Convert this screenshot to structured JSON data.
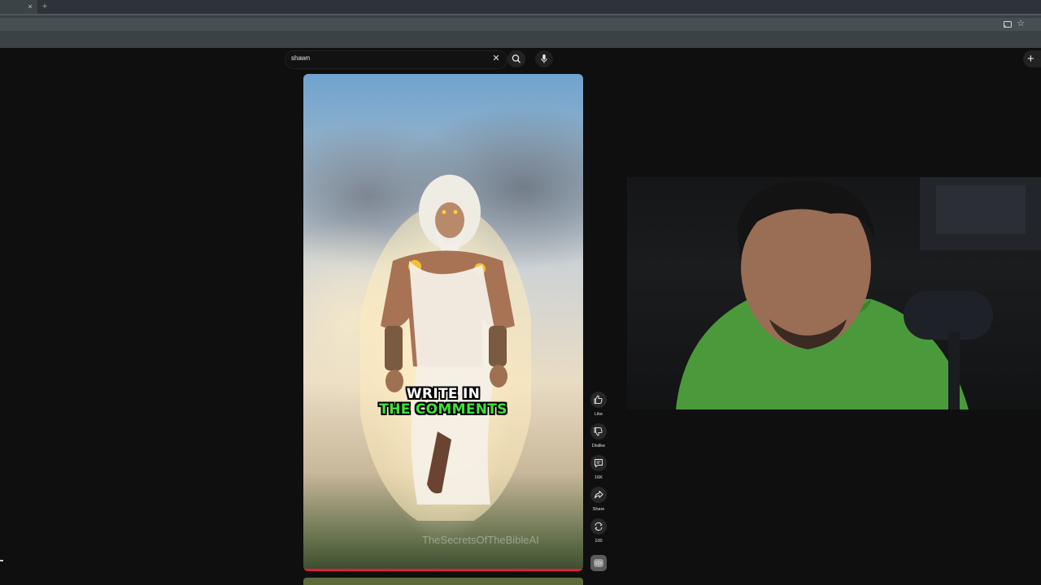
{
  "browser": {
    "tab_close": "×",
    "new_tab": "+",
    "star_glyph": "☆",
    "icons": [
      "close-icon",
      "plus-icon",
      "cast-icon",
      "star-icon"
    ]
  },
  "header": {
    "search_value": "shawn",
    "clear_glyph": "✕",
    "create_glyph": "+",
    "icons": [
      "search-icon",
      "mic-icon",
      "create-plus-icon"
    ]
  },
  "video": {
    "caption_line1": "WRITE IN",
    "caption_line2": "THE COMMENTS",
    "caption_line2_color": "#41e33a",
    "watermark": "TheSecretsOfTheBibleAI",
    "progress_fraction": 1.0,
    "progress_color": "#e01e3c"
  },
  "actions": {
    "like_label": "Like",
    "dislike_label": "Dislike",
    "comments_count": "16K",
    "share_label": "Share",
    "remix_count": "100",
    "icons": [
      "thumb-up-icon",
      "thumb-down-icon",
      "comment-icon",
      "share-icon",
      "remix-icon",
      "sound-avatar-icon"
    ]
  },
  "colors": {
    "page_bg": "#0f0f0f",
    "chrome_bg": "#3a4246",
    "action_btn_bg": "#272727"
  }
}
